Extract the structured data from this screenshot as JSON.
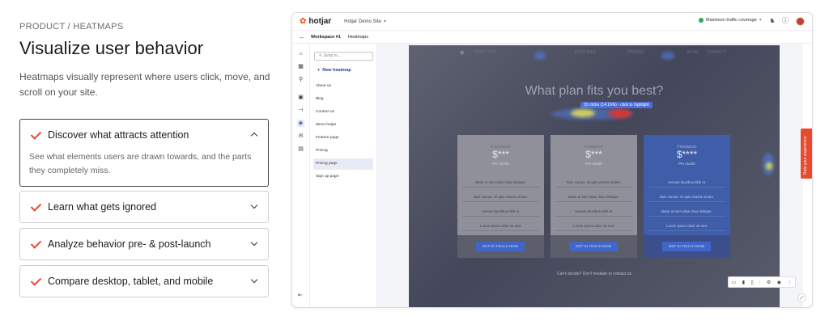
{
  "section": {
    "eyebrow": "PRODUCT / HEATMAPS",
    "title": "Visualize user behavior",
    "lead": "Heatmaps visually represent where users click, move, and scroll on your site."
  },
  "accordion": [
    {
      "title": "Discover what attracts attention",
      "expanded": true,
      "body": "See what elements users are drawn towards, and the parts they completely miss."
    },
    {
      "title": "Learn what gets ignored",
      "expanded": false
    },
    {
      "title": "Analyze behavior pre- & post-launch",
      "expanded": false
    },
    {
      "title": "Compare desktop, tablet, and mobile",
      "expanded": false
    }
  ],
  "app": {
    "logo": "hotjar",
    "site_selector": "Hotjar Demo Site",
    "coverage": "Maximum traffic coverage",
    "breadcrumb": {
      "workspace": "Workspace #1",
      "page": "Heatmaps"
    },
    "search_placeholder": "Jump to...",
    "new_heatmap": "New heatmap",
    "pages": [
      "About us",
      "Blog",
      "Contact us",
      "demo.hotjar",
      "Feature page",
      "Pricing",
      "Pricing page",
      "Sign up page"
    ],
    "selected_page": "Pricing page",
    "feedback_tab": "Rate your experience"
  },
  "preview": {
    "nav_brand": "DEMO SITE",
    "nav_links": [
      "FEATURES",
      "PRICING",
      "BLOG",
      "CONTACT"
    ],
    "heading": "What plan fits you best?",
    "tooltip": "33 clicks (14.16%) - click to highlight",
    "plans": [
      {
        "tier": "Freelancer",
        "price": "$***",
        "per": "Per month",
        "features": [
          "Basic ut sem vitae risus tristique.",
          "Duis cursus, mi quis viverra ornare.",
          "Aenean faucibus nibh et.",
          "Lorem ipsum dolor sit ame"
        ],
        "cta": "GET IN TOUCH NOW",
        "highlight": false
      },
      {
        "tier": "Freelancer",
        "price": "$***",
        "per": "Per month",
        "features": [
          "Duis cursus, mi quis viverra ornare.",
          "Basic ut sem vitae risus tristique.",
          "Aenean faucibus nibh et.",
          "Lorem ipsum dolor sit ame"
        ],
        "cta": "GET IN TOUCH NOW",
        "highlight": false
      },
      {
        "tier": "Freelancer",
        "price": "$****",
        "per": "Per month",
        "features": [
          "Aenean faucibus nibh et.",
          "Duis cursus, mi quis viverra ornare.",
          "Basic ut sem vitae risus tristique.",
          "Lorem ipsum dolor sit ame"
        ],
        "cta": "GET IN TOUCH NOW",
        "highlight": true
      }
    ],
    "contact_line": "Can't decide? Don't hesitate to contact us"
  },
  "colors": {
    "accent": "#e8492f",
    "brand": "#ff3c00",
    "primary_blue": "#2b3a8c"
  }
}
